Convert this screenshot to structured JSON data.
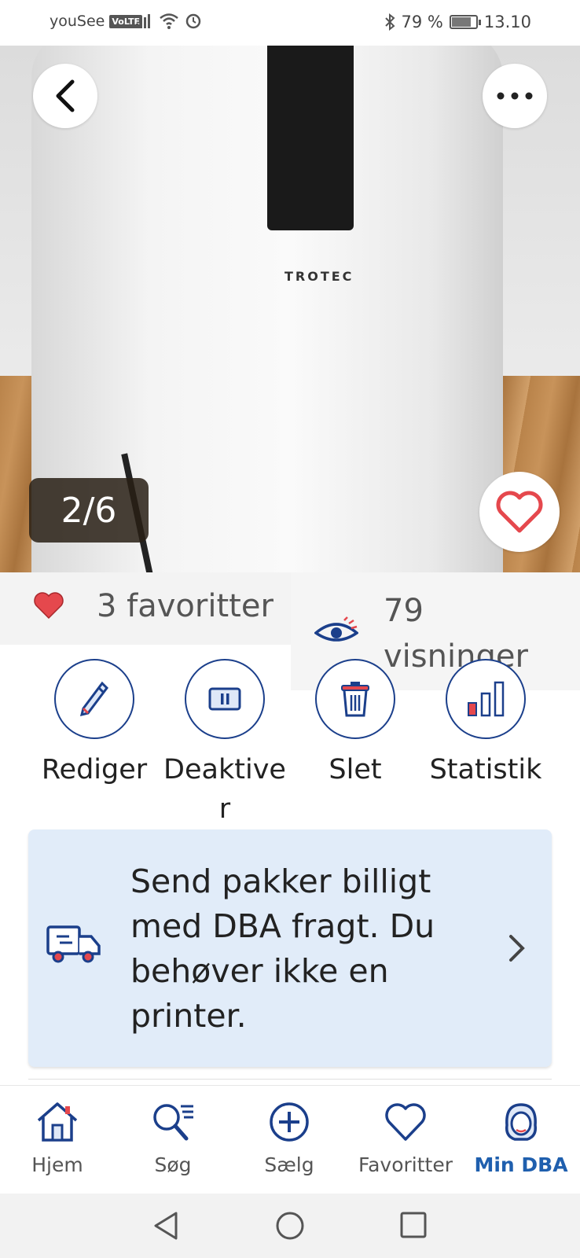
{
  "status_bar": {
    "carrier": "youSee",
    "volte": "VoLTE",
    "battery": "79 %",
    "battery_level": 0.79,
    "time": "13.10"
  },
  "gallery": {
    "brand_text": "TROTEC",
    "counter": "2/6"
  },
  "stats": {
    "favorites": "3 favoritter",
    "views_number": "79",
    "views_label": "visninger"
  },
  "actions": [
    {
      "label": "Rediger",
      "icon": "pencil-icon"
    },
    {
      "label": "Deaktiver",
      "icon": "pause-icon"
    },
    {
      "label": "Slet",
      "icon": "trash-icon"
    },
    {
      "label": "Statistik",
      "icon": "bar-chart-icon"
    }
  ],
  "banner": {
    "text": "Send pakker billigt med DBA fragt. Du behøver ikke en printer."
  },
  "bottom_nav": {
    "items": [
      {
        "label": "Hjem",
        "icon": "home-icon"
      },
      {
        "label": "Søg",
        "icon": "search-icon"
      },
      {
        "label": "Sælg",
        "icon": "plus-circle-icon"
      },
      {
        "label": "Favoritter",
        "icon": "heart-icon"
      },
      {
        "label": "Min DBA",
        "icon": "profile-icon"
      }
    ],
    "active_index": 4
  },
  "colors": {
    "accent": "#1b3f8b",
    "active_nav": "#1f5fae",
    "heart": "#e5484d",
    "banner_bg": "#e1ecf9"
  }
}
